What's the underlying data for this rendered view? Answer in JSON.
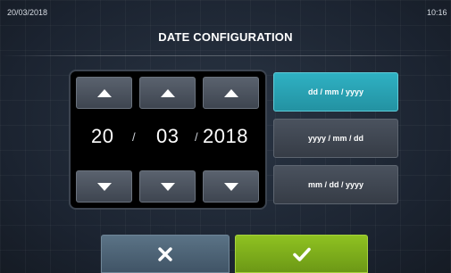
{
  "header": {
    "date": "20/03/2018",
    "time": "10:16"
  },
  "title": "DATE CONFIGURATION",
  "picker": {
    "day": "20",
    "month": "03",
    "year": "2018",
    "separator": "/"
  },
  "formats": [
    {
      "label": "dd / mm / yyyy",
      "selected": true
    },
    {
      "label": "yyyy / mm / dd",
      "selected": false
    },
    {
      "label": "mm / dd / yyyy",
      "selected": false
    }
  ],
  "actions": {
    "cancel_icon": "close-icon",
    "confirm_icon": "check-icon"
  },
  "colors": {
    "selected_format": "#2fb1c3",
    "confirm": "#8fc221",
    "cancel": "#5b7386",
    "background": "#1b2330"
  }
}
